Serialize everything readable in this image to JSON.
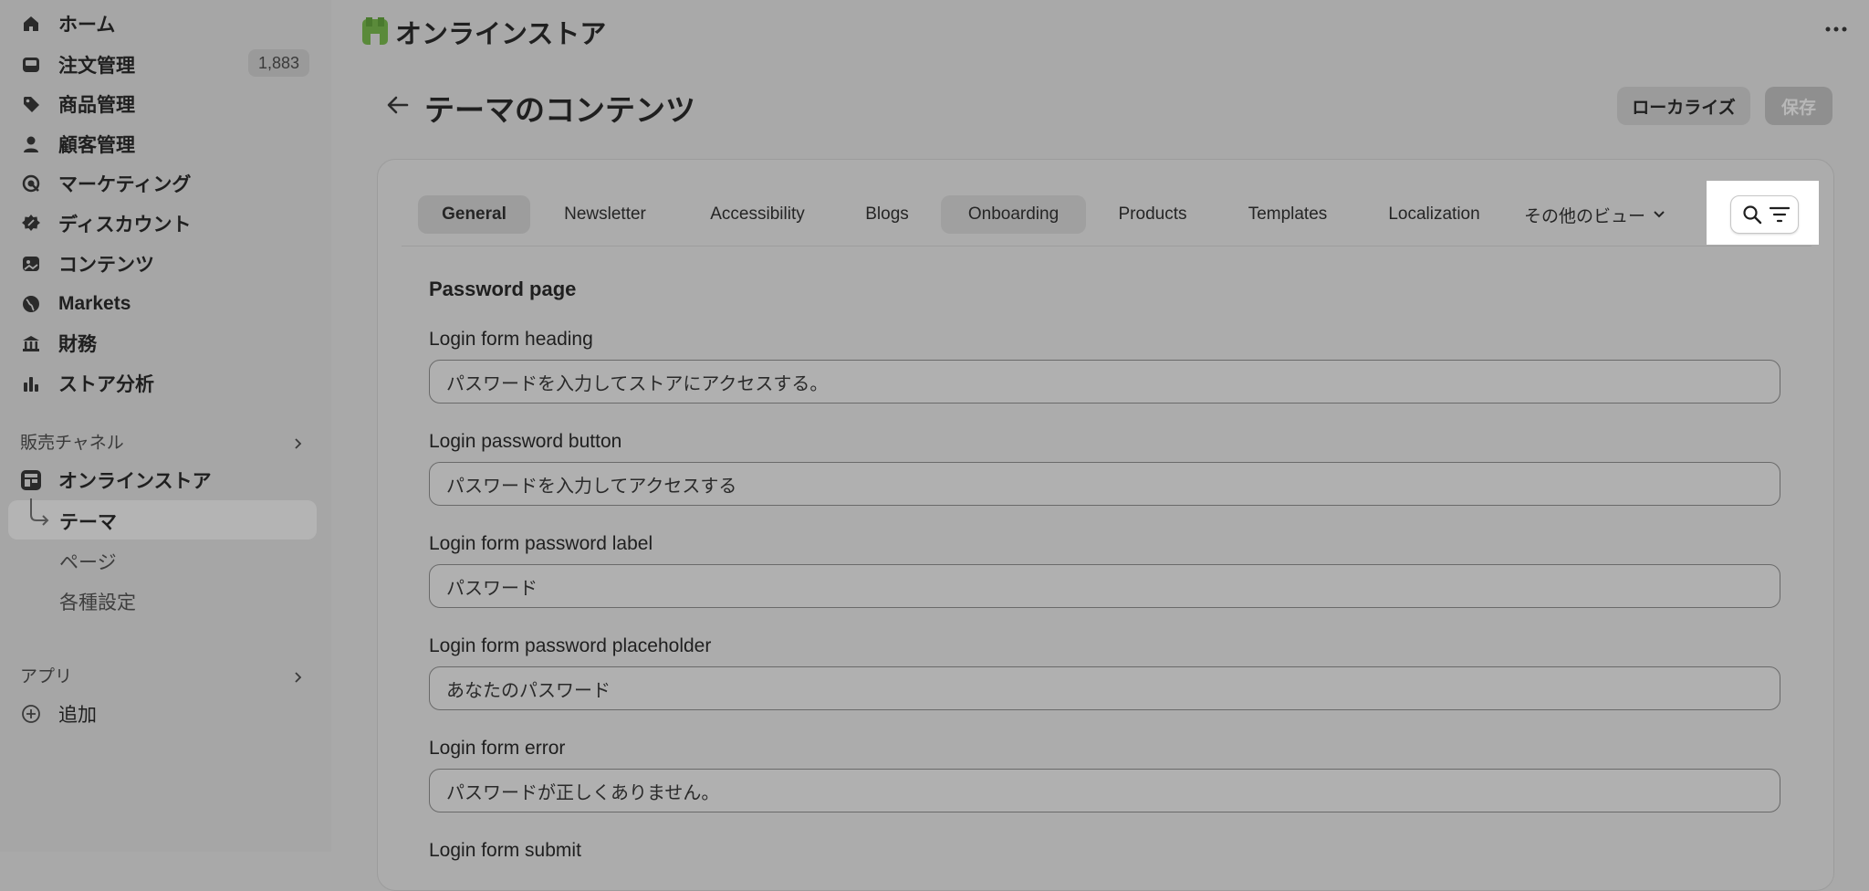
{
  "sidebar": {
    "items": [
      {
        "label": "ホーム",
        "icon": "home-icon"
      },
      {
        "label": "注文管理",
        "icon": "inbox-icon",
        "badge": "1,883"
      },
      {
        "label": "商品管理",
        "icon": "tag-icon"
      },
      {
        "label": "顧客管理",
        "icon": "person-icon"
      },
      {
        "label": "マーケティング",
        "icon": "target-icon"
      },
      {
        "label": "ディスカウント",
        "icon": "discount-icon"
      },
      {
        "label": "コンテンツ",
        "icon": "image-icon"
      },
      {
        "label": "Markets",
        "icon": "globe-icon"
      },
      {
        "label": "財務",
        "icon": "bank-icon"
      },
      {
        "label": "ストア分析",
        "icon": "bar-chart-icon"
      }
    ],
    "sales_channels_label": "販売チャネル",
    "online_store_label": "オンラインストア",
    "sub_items": [
      "テーマ",
      "ページ",
      "各種設定"
    ],
    "apps_label": "アプリ",
    "add_label": "追加"
  },
  "header": {
    "store_title": "オンラインストア",
    "page_title": "テーマのコンテンツ",
    "localize_label": "ローカライズ",
    "save_label": "保存"
  },
  "tabs": [
    "General",
    "Newsletter",
    "Accessibility",
    "Blogs",
    "Onboarding",
    "Products",
    "Templates",
    "Localization",
    "その他のビュー"
  ],
  "section": {
    "title": "Password page",
    "fields": [
      {
        "label": "Login form heading",
        "value": "パスワードを入力してストアにアクセスする。"
      },
      {
        "label": "Login password button",
        "value": "パスワードを入力してアクセスする"
      },
      {
        "label": "Login form password label",
        "value": "パスワード"
      },
      {
        "label": "Login form password placeholder",
        "value": "あなたのパスワード"
      },
      {
        "label": "Login form error",
        "value": "パスワードが正しくありません。"
      },
      {
        "label": "Login form submit",
        "value": ""
      }
    ]
  },
  "colors": {
    "overlay_gray": "#a9a9a9",
    "highlight_white": "#ffffff",
    "store_icon_green": "#5a8a3a"
  }
}
